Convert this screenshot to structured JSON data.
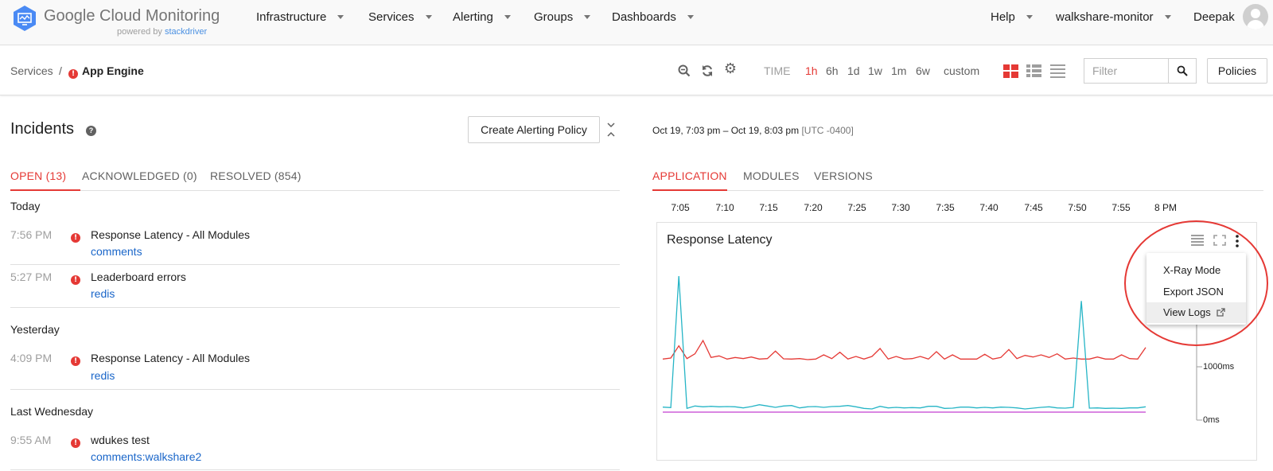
{
  "header": {
    "logo_text": "Google Cloud Monitoring",
    "powered_by": "powered by",
    "powered_brand": "stackdriver",
    "nav": [
      "Infrastructure",
      "Services",
      "Alerting",
      "Groups",
      "Dashboards"
    ],
    "help_label": "Help",
    "project_label": "walkshare-monitor",
    "user_name": "Deepak"
  },
  "toolbar": {
    "breadcrumb_root": "Services",
    "breadcrumb_sep": "/",
    "breadcrumb_current": "App Engine",
    "time_label": "TIME",
    "time_options": [
      "1h",
      "6h",
      "1d",
      "1w",
      "1m",
      "6w",
      "custom"
    ],
    "time_selected": "1h",
    "filter_placeholder": "Filter",
    "policies_label": "Policies",
    "icons": [
      "zoom-out-icon",
      "refresh-icon",
      "settings-icon",
      "grid-view-icon",
      "list-view-icon",
      "compact-list-icon",
      "search-icon"
    ]
  },
  "incidents": {
    "title": "Incidents",
    "create_button": "Create Alerting Policy",
    "tabs": [
      "OPEN (13)",
      "ACKNOWLEDGED (0)",
      "RESOLVED (854)"
    ],
    "groups": [
      {
        "label": "Today",
        "items": [
          {
            "time": "7:56 PM",
            "name": "Response Latency - All Modules",
            "resource": "comments"
          },
          {
            "time": "5:27 PM",
            "name": "Leaderboard errors",
            "resource": "redis"
          }
        ]
      },
      {
        "label": "Yesterday",
        "items": [
          {
            "time": "4:09 PM",
            "name": "Response Latency - All Modules",
            "resource": "redis"
          }
        ]
      },
      {
        "label": "Last Wednesday",
        "items": [
          {
            "time": "9:55 AM",
            "name": "wdukes test",
            "resource": "comments:walkshare2"
          }
        ]
      }
    ]
  },
  "charts": {
    "range": "Oct 19, 7:03 pm – Oct 19, 8:03 pm",
    "timezone": "[UTC -0400]",
    "tabs": [
      "APPLICATION",
      "MODULES",
      "VERSIONS"
    ],
    "ticks": [
      "7:05",
      "7:10",
      "7:15",
      "7:20",
      "7:25",
      "7:30",
      "7:35",
      "7:40",
      "7:45",
      "7:50",
      "7:55",
      "8 PM"
    ],
    "card_title": "Response Latency",
    "menu": [
      "X-Ray Mode",
      "Export JSON",
      "View Logs"
    ],
    "colors": {
      "accent": "#e53935",
      "link": "#1a66c9",
      "series_cyan": "#26b5c6",
      "series_red": "#e53935",
      "series_magenta": "#c43fd1"
    }
  },
  "chart_data": {
    "type": "line",
    "title": "Response Latency",
    "x": [
      "7:05",
      "7:10",
      "7:15",
      "7:20",
      "7:25",
      "7:30",
      "7:35",
      "7:40",
      "7:45",
      "7:50",
      "7:55",
      "8 PM"
    ],
    "ylabel": "",
    "y_ticks": [
      "1000ms",
      "0ms"
    ],
    "ylim": [
      0,
      3000
    ],
    "series": [
      {
        "color": "#e53935",
        "values": [
          1000,
          1020,
          1250,
          1010,
          1100,
          1350,
          1030,
          1060,
          1000,
          1030,
          1010,
          1040,
          1000,
          1010,
          1150,
          1005,
          1000,
          1010,
          990,
          1000,
          1080,
          1010,
          1130,
          1000,
          1050,
          1000,
          1050,
          1200,
          1000,
          1050,
          1000,
          1010,
          1050,
          1000,
          1140,
          1000,
          1080,
          1000,
          1000,
          1000,
          1090,
          1000,
          1030,
          1180,
          1010,
          1070,
          1040,
          1080,
          1030,
          1100,
          1000,
          1020,
          1000,
          1000,
          1040,
          1000,
          1000,
          1080,
          1010,
          1000,
          1220
        ]
      },
      {
        "color": "#26b5c6",
        "values": [
          95,
          85,
          2565,
          70,
          115,
          100,
          110,
          100,
          105,
          100,
          80,
          105,
          140,
          115,
          90,
          115,
          125,
          80,
          100,
          105,
          90,
          105,
          110,
          125,
          100,
          70,
          60,
          110,
          80,
          90,
          80,
          85,
          80,
          110,
          110,
          70,
          75,
          95,
          95,
          80,
          90,
          80,
          95,
          90,
          80,
          60,
          75,
          90,
          100,
          80,
          75,
          90,
          2095,
          75,
          80,
          70,
          75,
          70,
          80,
          80,
          100
        ]
      },
      {
        "color": "#c43fd1",
        "values": [
          0,
          0,
          0,
          0,
          0,
          0,
          0,
          0,
          0,
          0,
          0,
          0,
          0,
          0,
          0,
          0,
          0,
          0,
          0,
          0,
          0,
          0,
          0,
          0,
          0,
          0,
          0,
          0,
          0,
          0,
          0,
          0,
          0,
          0,
          0,
          0,
          0,
          0,
          0,
          0,
          0,
          0,
          0,
          0,
          0,
          0,
          0,
          0,
          0,
          0,
          0,
          0,
          0,
          0,
          0,
          0,
          0,
          0,
          0,
          0,
          0
        ]
      }
    ],
    "grid": false,
    "legend": "none"
  }
}
